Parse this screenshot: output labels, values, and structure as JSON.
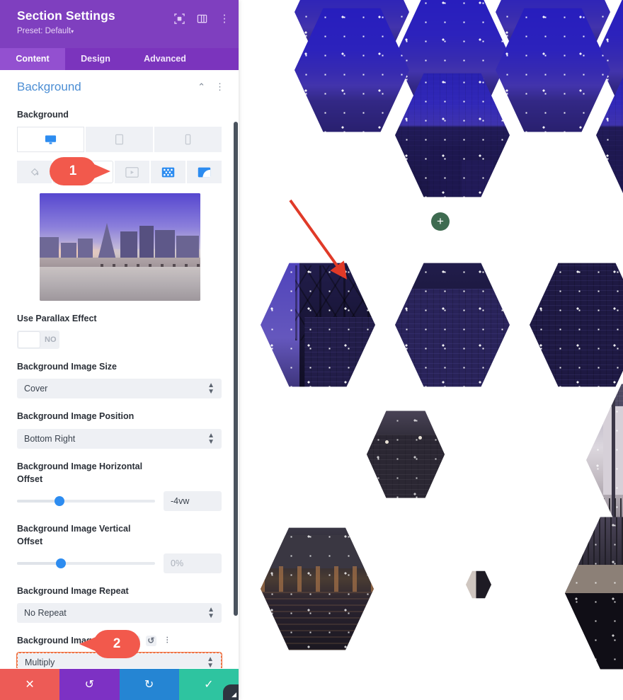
{
  "panel": {
    "title": "Section Settings",
    "preset_label": "Preset: Default",
    "preset_caret": "▾",
    "header_icons": [
      {
        "name": "expand-icon",
        "glyph": "⛶"
      },
      {
        "name": "layout-columns-icon",
        "glyph": "▤"
      },
      {
        "name": "more-options-icon",
        "glyph": "⋮"
      }
    ],
    "tabs": [
      {
        "label": "Content",
        "active": true
      },
      {
        "label": "Design",
        "active": false
      },
      {
        "label": "Advanced",
        "active": false
      }
    ],
    "section": {
      "title": "Background",
      "collapse_icon": "⌃",
      "more_icon": "⋮"
    }
  },
  "fields": {
    "background_label": "Background",
    "devices": [
      {
        "name": "desktop-icon",
        "glyph": "🖥",
        "active": true
      },
      {
        "name": "tablet-icon",
        "glyph": "▢",
        "active": false
      },
      {
        "name": "phone-icon",
        "glyph": "▯",
        "active": false
      }
    ],
    "bg_types": [
      {
        "name": "background-color-icon",
        "glyph": "◌",
        "state": "inactive"
      },
      {
        "name": "background-image-icon",
        "glyph": "▣",
        "state": "selected"
      },
      {
        "name": "background-video-icon",
        "glyph": "▶",
        "state": "inactive"
      },
      {
        "name": "background-pattern-icon",
        "glyph": "▩",
        "state": "active"
      },
      {
        "name": "background-mask-icon",
        "glyph": "◩",
        "state": "active"
      }
    ],
    "parallax": {
      "label": "Use Parallax Effect",
      "value": "NO"
    },
    "image_size": {
      "label": "Background Image Size",
      "value": "Cover"
    },
    "image_position": {
      "label": "Background Image Position",
      "value": "Bottom Right"
    },
    "horizontal_offset": {
      "label": "Background Image Horizontal Offset",
      "value": "-4vw",
      "slider_percent": 31
    },
    "vertical_offset": {
      "label": "Background Image Vertical Offset",
      "value": "",
      "placeholder": "0%",
      "slider_percent": 32
    },
    "image_repeat": {
      "label": "Background Image Repeat",
      "value": "No Repeat"
    },
    "image_blend": {
      "label": "Background Image Blend",
      "value": "Multiply",
      "modified": true,
      "icons": [
        {
          "name": "help-icon",
          "glyph": "?"
        },
        {
          "name": "reset-icon",
          "glyph": "↺"
        },
        {
          "name": "more-options-icon",
          "glyph": "⋮"
        }
      ]
    }
  },
  "actions": [
    {
      "name": "cancel-button",
      "glyph": "✕",
      "color": "#ed5b56"
    },
    {
      "name": "undo-button",
      "glyph": "↺",
      "color": "#7d31c4"
    },
    {
      "name": "redo-button",
      "glyph": "↻",
      "color": "#2585d3"
    },
    {
      "name": "save-button",
      "glyph": "✓",
      "color": "#2ec4a0"
    }
  ],
  "canvas": {
    "add_button_label": "+",
    "callouts": [
      {
        "number": "1",
        "direction": "right"
      },
      {
        "number": "2",
        "direction": "left"
      }
    ]
  },
  "colors": {
    "header_purple": "#7f3fbf",
    "tab_active_purple": "#9350d0",
    "accent_blue": "#4c8ed4",
    "slider_blue": "#2d8cf0",
    "callout_red": "#f2594c",
    "modified_orange": "#f0703f",
    "hex_tint": "#5b4ae0"
  }
}
